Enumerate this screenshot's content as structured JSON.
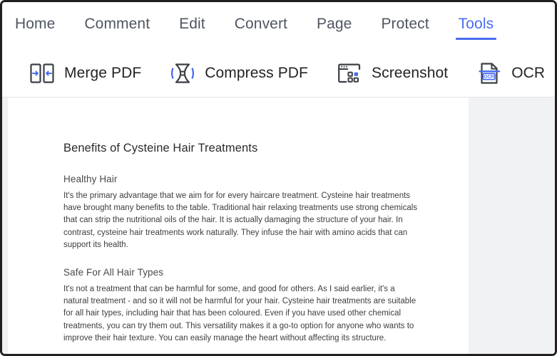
{
  "window": {
    "accent_color": "#4a6cf0",
    "tab_text_color": "#4f5561",
    "page_background": "#ffffff",
    "panel_background": "#f1f2f4"
  },
  "ribbon": {
    "tabs": [
      {
        "label": "Home",
        "icon": "tab-home",
        "active": false
      },
      {
        "label": "Comment",
        "icon": "tab-comment",
        "active": false
      },
      {
        "label": "Edit",
        "icon": "tab-edit",
        "active": false
      },
      {
        "label": "Convert",
        "icon": "tab-convert",
        "active": false
      },
      {
        "label": "Page",
        "icon": "tab-page",
        "active": false
      },
      {
        "label": "Protect",
        "icon": "tab-protect",
        "active": false
      },
      {
        "label": "Tools",
        "icon": "tab-tools",
        "active": true
      }
    ]
  },
  "toolbar": {
    "buttons": [
      {
        "label": "Merge PDF",
        "icon": "merge-pdf-icon"
      },
      {
        "label": "Compress PDF",
        "icon": "compress-pdf-icon"
      },
      {
        "label": "Screenshot",
        "icon": "screenshot-icon"
      },
      {
        "label": "OCR",
        "icon": "ocr-icon"
      }
    ],
    "ocr_icon_text": "OCR"
  },
  "document": {
    "title": "Benefits of Cysteine Hair Treatments",
    "sections": [
      {
        "heading": "Healthy Hair",
        "paragraph": "It's the primary advantage that we aim for for every haircare treatment. Cysteine hair treatments have brought many benefits to the table. Traditional hair relaxing treatments use strong chemicals that can strip the nutritional oils of the hair. It is actually damaging the structure of your hair. In contrast, cysteine hair treatments work naturally. They infuse the hair with amino acids that can support its health."
      },
      {
        "heading": "Safe For All Hair Types",
        "paragraph": "It's not a treatment that can be harmful for some, and good for others. As I said earlier, it's a natural treatment - and so it will not be harmful for your hair. Cysteine hair treatments are suitable for all hair types, including hair that has been coloured. Even if you have used other chemical treatments, you can try them out. This versatility makes it a go-to option for anyone who wants to improve their hair texture. You can easily manage the heart without affecting its structure."
      }
    ]
  }
}
